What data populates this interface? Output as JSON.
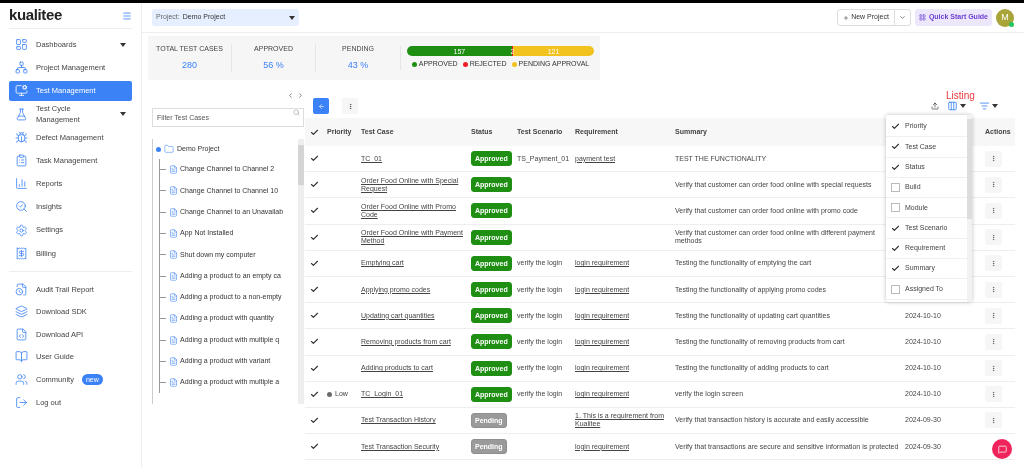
{
  "logo": "kualitee",
  "sidebar": {
    "items": [
      {
        "label": "Dashboards",
        "caret": true,
        "selected": false
      },
      {
        "label": "Project Management",
        "caret": false,
        "selected": false
      },
      {
        "label": "Test Management",
        "caret": false,
        "selected": true
      },
      {
        "label": "Test Cycle Management",
        "caret": true,
        "selected": false
      },
      {
        "label": "Defect Management",
        "caret": false,
        "selected": false
      },
      {
        "label": "Task Management",
        "caret": false,
        "selected": false
      },
      {
        "label": "Reports",
        "caret": false,
        "selected": false
      },
      {
        "label": "Insights",
        "caret": false,
        "selected": false
      },
      {
        "label": "Settings",
        "caret": false,
        "selected": false
      },
      {
        "label": "Billing",
        "caret": false,
        "selected": false
      }
    ],
    "bottom_items": [
      {
        "label": "Audit Trail Report"
      },
      {
        "label": "Download SDK"
      },
      {
        "label": "Download API"
      },
      {
        "label": "User Guide"
      },
      {
        "label": "Community",
        "badge": "new"
      },
      {
        "label": "Log out"
      }
    ]
  },
  "project_selector": {
    "label": "Project:",
    "value": "Demo Project"
  },
  "header_buttons": {
    "new_project": "New Project",
    "quick_start": "Quick Start Guide",
    "avatar": "M"
  },
  "stats": [
    {
      "label": "TOTAL TEST CASES",
      "value": "280"
    },
    {
      "label": "APPROVED",
      "value": "56 %"
    },
    {
      "label": "PENDING",
      "value": "43 %"
    }
  ],
  "progress": {
    "segments": [
      {
        "label": "157",
        "level": 0.5607,
        "color": "#1f8f14"
      },
      {
        "label": "2",
        "level": 0.0071,
        "color": "#ee1c25"
      },
      {
        "label": "121",
        "level": 0.4322,
        "color": "#f2c31e"
      }
    ],
    "legend": [
      {
        "label": "APPROVED",
        "color": "#1f8f14"
      },
      {
        "label": "REJECTED",
        "color": "#ee1c25"
      },
      {
        "label": "PENDING APPROVAL",
        "color": "#f2c31e"
      }
    ]
  },
  "tree": {
    "filter_placeholder": "Filter Test Cases",
    "root": {
      "label": "Demo Project",
      "expanded": true,
      "children": [
        {
          "label": "Change Channel to Channel 2"
        },
        {
          "label": "Change Channel to Channel 10"
        },
        {
          "label": "Change Channel to an Unavailab"
        },
        {
          "label": "App Not Installed"
        },
        {
          "label": "Shut down my computer"
        },
        {
          "label": "Adding a product to an empty ca"
        },
        {
          "label": "Adding a product to a non-empty"
        },
        {
          "label": "Adding a product with quantity"
        },
        {
          "label": "Adding a product with multiple q"
        },
        {
          "label": "Adding a product with variant"
        },
        {
          "label": "Adding a product with multiple a"
        }
      ]
    }
  },
  "listing_annotation": "Listing",
  "table": {
    "all_checked": true,
    "columns": [
      "Priority",
      "Test Case",
      "Status",
      "Test Scenario",
      "Requirement",
      "Summary",
      "Actions"
    ],
    "rows": [
      {
        "checked": true,
        "test_case": "TC_01",
        "status": {
          "label": "Approved",
          "kind": "approved"
        },
        "scenario": "TS_Payment_01",
        "requirement": "payment test",
        "summary": "TEST THE FUNCTIONALITY"
      },
      {
        "checked": true,
        "test_case": "Order Food Online with Special Request",
        "status": {
          "label": "Approved",
          "kind": "approved"
        },
        "summary": "Verify that customer can order food online with special requests"
      },
      {
        "checked": true,
        "test_case": "Order Food Online with Promo Code",
        "status": {
          "label": "Approved",
          "kind": "approved"
        },
        "summary": "Verify that customer can order food online with promo code"
      },
      {
        "checked": true,
        "test_case": "Order Food Online with Payment Method",
        "status": {
          "label": "Approved",
          "kind": "approved"
        },
        "summary": "Verify that customer can order food online with different payment methods"
      },
      {
        "checked": true,
        "test_case": "Emptying cart",
        "status": {
          "label": "Approved",
          "kind": "approved"
        },
        "scenario": "verify the login",
        "requirement": "login requirement",
        "summary": "Testing the functionality of emptying the cart"
      },
      {
        "checked": true,
        "test_case": "Applying promo codes",
        "status": {
          "label": "Approved",
          "kind": "approved"
        },
        "scenario": "verify the login",
        "requirement": "login requirement",
        "summary": "Testing the functionality of applying promo codes"
      },
      {
        "checked": true,
        "test_case": "Updating cart quantities",
        "status": {
          "label": "Approved",
          "kind": "approved"
        },
        "scenario": "verify the login",
        "requirement": "login requirement",
        "summary": "Testing the functionality of updating cart quantities",
        "date": "2024-10-10"
      },
      {
        "checked": true,
        "test_case": "Removing products from cart",
        "status": {
          "label": "Approved",
          "kind": "approved"
        },
        "scenario": "verify the login",
        "requirement": "login requirement",
        "summary": "Testing the functionality of removing products from cart",
        "date": "2024-10-10"
      },
      {
        "checked": true,
        "test_case": "Adding products to cart",
        "status": {
          "label": "Approved",
          "kind": "approved"
        },
        "scenario": "verify the login",
        "requirement": "login requirement",
        "summary": "Testing the functionality of adding products to cart",
        "date": "2024-10-10"
      },
      {
        "checked": true,
        "priority": {
          "label": "Low",
          "color": "#6b6b6b"
        },
        "test_case": "TC_Login_01",
        "status": {
          "label": "Approved",
          "kind": "approved"
        },
        "scenario": "verify the login",
        "requirement": "login requirement",
        "summary": "verify the login screen",
        "date": "2024-10-10"
      },
      {
        "checked": true,
        "test_case": "Test Transaction History",
        "status": {
          "label": "Pending",
          "kind": "pending"
        },
        "requirement": "1. This is a requirement from Kualitee",
        "summary": "Verify that transaction history is accurate and easily accessible",
        "date": "2024-09-30"
      },
      {
        "checked": true,
        "test_case": "Test Transaction Security",
        "status": {
          "label": "Pending",
          "kind": "pending"
        },
        "requirement": "login requirement",
        "summary": "Verify that transactions are secure and sensitive information is protected",
        "date": "2024-09-30"
      }
    ]
  },
  "column_menu": [
    {
      "label": "Priority",
      "checked": true
    },
    {
      "label": "Test Case",
      "checked": true
    },
    {
      "label": "Status",
      "checked": true
    },
    {
      "label": "Build",
      "checked": false
    },
    {
      "label": "Module",
      "checked": false
    },
    {
      "label": "Test Scenario",
      "checked": true
    },
    {
      "label": "Requirement",
      "checked": true
    },
    {
      "label": "Summary",
      "checked": true
    },
    {
      "label": "Assigned To",
      "checked": false
    }
  ]
}
